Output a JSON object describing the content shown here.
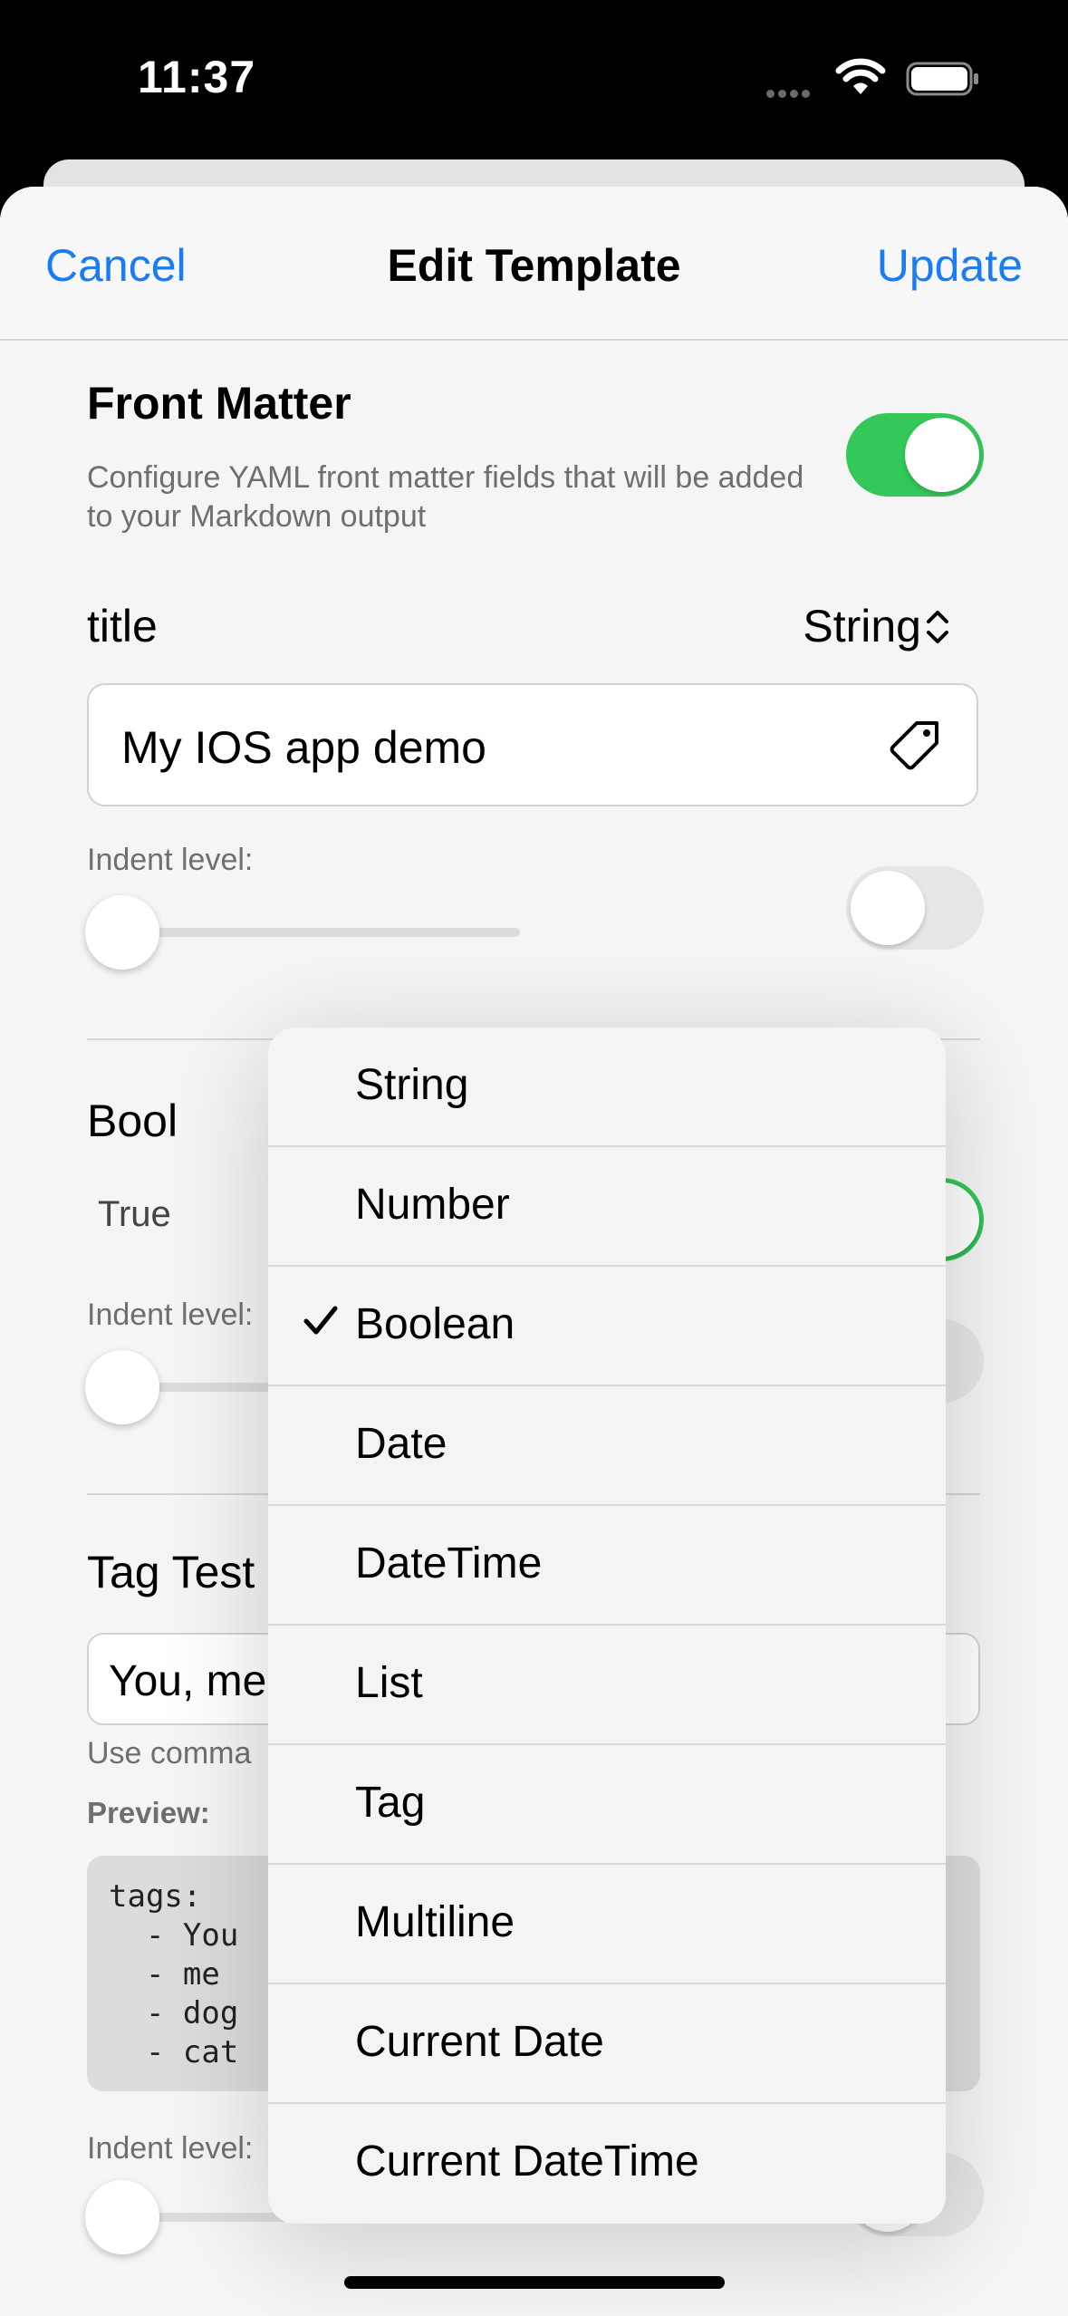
{
  "status_bar": {
    "time": "11:37"
  },
  "nav": {
    "cancel": "Cancel",
    "title": "Edit Template",
    "update": "Update"
  },
  "front_matter": {
    "title": "Front Matter",
    "description": "Configure YAML front matter fields that will be added to your Markdown output",
    "enabled": true
  },
  "fields": [
    {
      "name": "title",
      "type": "String",
      "value": "My IOS app demo",
      "indent_label": "Indent level:"
    },
    {
      "name": "Bool",
      "value": "True",
      "indent_label": "Indent level:"
    },
    {
      "name": "Tag Test",
      "value": "You, me",
      "helper": "Use comma",
      "preview_label": "Preview:",
      "preview": "tags:\n  - You\n  - me\n  - dog\n  - cat",
      "indent_label": "Indent level:"
    }
  ],
  "dropdown": {
    "selected": "Boolean",
    "options": [
      "String",
      "Number",
      "Boolean",
      "Date",
      "DateTime",
      "List",
      "Tag",
      "Multiline",
      "Current Date",
      "Current DateTime"
    ]
  },
  "icons": {
    "wifi": "wifi-icon",
    "battery": "battery-icon",
    "tag": "tag-icon",
    "chevrons": "chevron-up-down-icon",
    "check": "checkmark-icon"
  },
  "colors": {
    "accent": "#1a7cf5",
    "toggle_on": "#34c759"
  }
}
